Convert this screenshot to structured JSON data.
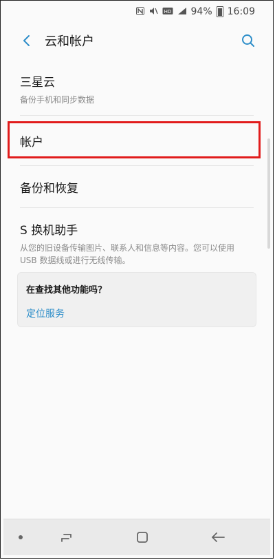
{
  "status_bar": {
    "battery_percent": "94%",
    "time": "16:09",
    "icons": [
      "nfc-icon",
      "mute-vibrate-icon",
      "hd-icon",
      "signal-icon",
      "battery-icon"
    ]
  },
  "header": {
    "title": "云和帐户",
    "back_icon": "chevron-left-icon",
    "search_icon": "search-icon",
    "accent_color": "#2e8ec9"
  },
  "list": {
    "samsung_cloud": {
      "title": "三星云",
      "subtitle": "备份手机和同步数据"
    },
    "accounts": {
      "title": "帐户",
      "highlight_color": "#e11c1c"
    },
    "backup_restore": {
      "title": "备份和恢复"
    },
    "smart_switch": {
      "title": "S 换机助手",
      "subtitle": "从您的旧设备传输图片、联系人和信息等内容。您可以使用 USB 数据线或进行无线传输。"
    }
  },
  "suggestion_card": {
    "question": "在查找其他功能吗？",
    "link": "定位服务"
  },
  "nav_bar": {
    "icons": [
      "recents-icon",
      "home-icon",
      "back-icon"
    ]
  }
}
